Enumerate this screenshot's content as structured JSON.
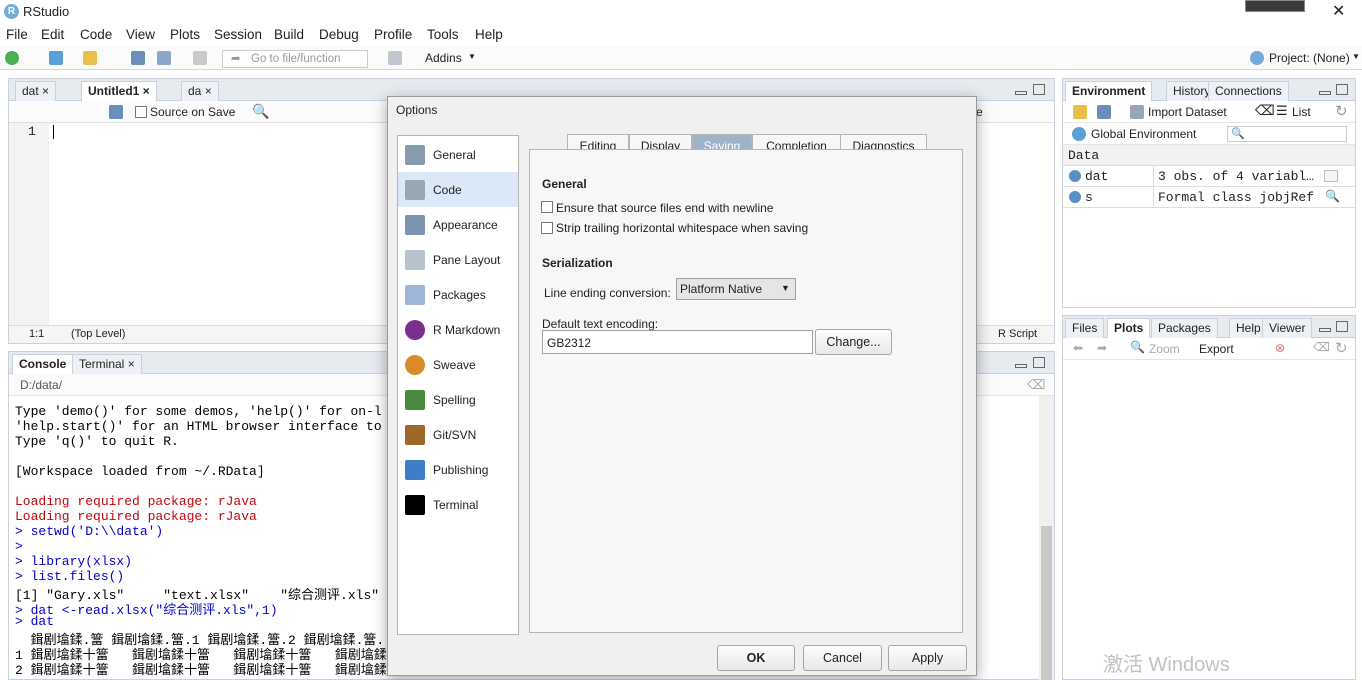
{
  "window": {
    "title": "RStudio",
    "close_glyph": "✕"
  },
  "menu": [
    "File",
    "Edit",
    "Code",
    "View",
    "Plots",
    "Session",
    "Build",
    "Debug",
    "Profile",
    "Tools",
    "Help"
  ],
  "toolbar": {
    "goto_placeholder": "Go to file/function",
    "addins_label": "Addins",
    "project_label": "Project: (None)"
  },
  "editor": {
    "tabs": [
      "dat",
      "Untitled1",
      "da"
    ],
    "source_on_save": "Source on Save",
    "line_number": "1",
    "status_position": "1:1",
    "status_scope": "(Top Level)",
    "status_type": "R Script",
    "source_fragment": "rce"
  },
  "console": {
    "tabs": [
      "Console",
      "Terminal"
    ],
    "path": "D:/data/",
    "lines": [
      {
        "cls": "blk",
        "text": "Type 'demo()' for some demos, 'help()' for on-l"
      },
      {
        "cls": "blk",
        "text": "'help.start()' for an HTML browser interface to"
      },
      {
        "cls": "blk",
        "text": "Type 'q()' to quit R."
      },
      {
        "cls": "blk",
        "text": ""
      },
      {
        "cls": "blk",
        "text": "[Workspace loaded from ~/.RData]"
      },
      {
        "cls": "blk",
        "text": ""
      },
      {
        "cls": "red",
        "text": "Loading required package: rJava"
      },
      {
        "cls": "red",
        "text": "Loading required package: rJava"
      },
      {
        "cls": "blue",
        "text": "> setwd('D:\\\\data')"
      },
      {
        "cls": "blue",
        "text": ">"
      },
      {
        "cls": "blue",
        "text": "> library(xlsx)"
      },
      {
        "cls": "blue",
        "text": "> list.files()"
      },
      {
        "cls": "blk",
        "text": "[1] \"Gary.xls\"     \"text.xlsx\"    \"综合测评.xls\""
      },
      {
        "cls": "blue",
        "text": "> dat <-read.xlsx(\"综合测评.xls\",1)"
      },
      {
        "cls": "blue",
        "text": "> dat"
      },
      {
        "cls": "blk",
        "text": "  鍓剧墖鍒.簹 鍓剧墖鍒.簹.1 鍓剧墖鍒.簹.2 鍓剧墖鍒.簹."
      },
      {
        "cls": "blk",
        "text": "1 鍓剧墖鍒十簹   鍓剧墖鍒十簹   鍓剧墖鍒十簹   鍓剧墖鍒"
      },
      {
        "cls": "blk",
        "text": "2 鍓剧墖鍒十簹   鍓剧墖鍒十簹   鍓剧墖鍒十簹   鍓剧墖鍒"
      }
    ]
  },
  "environment": {
    "tabs": [
      "Environment",
      "History",
      "Connections"
    ],
    "import_label": "Import Dataset",
    "list_label": "List",
    "global_env": "Global Environment",
    "section": "Data",
    "rows": [
      {
        "name": "dat",
        "value": "3 obs. of 4 variabl…"
      },
      {
        "name": "s",
        "value": "Formal class jobjRef"
      }
    ]
  },
  "files": {
    "tabs": [
      "Files",
      "Plots",
      "Packages",
      "Help",
      "Viewer"
    ],
    "zoom_label": "Zoom",
    "export_label": "Export"
  },
  "watermark": "激活 Windows",
  "dialog": {
    "title": "Options",
    "sidebar": [
      {
        "label": "General",
        "icon": "r-logo-icon",
        "color": "#8a9bb0"
      },
      {
        "label": "Code",
        "icon": "code-icon",
        "color": "#9aa6b2"
      },
      {
        "label": "Appearance",
        "icon": "appearance-icon",
        "color": "#7e93ad"
      },
      {
        "label": "Pane Layout",
        "icon": "pane-layout-icon",
        "color": "#b7c2ce"
      },
      {
        "label": "Packages",
        "icon": "packages-icon",
        "color": "#9fb6d6"
      },
      {
        "label": "R Markdown",
        "icon": "rmarkdown-icon",
        "color": "#7b2f8c"
      },
      {
        "label": "Sweave",
        "icon": "sweave-icon",
        "color": "#d98a2a"
      },
      {
        "label": "Spelling",
        "icon": "spelling-icon",
        "color": "#4a8a3a"
      },
      {
        "label": "Git/SVN",
        "icon": "git-svn-icon",
        "color": "#a0672a"
      },
      {
        "label": "Publishing",
        "icon": "publishing-icon",
        "color": "#3c7fc6"
      },
      {
        "label": "Terminal",
        "icon": "terminal-icon",
        "color": "#000000"
      }
    ],
    "tabs": [
      "Editing",
      "Display",
      "Saving",
      "Completion",
      "Diagnostics"
    ],
    "active_tab": "Saving",
    "general_heading": "General",
    "checkbox_newline": "Ensure that source files end with newline",
    "checkbox_whitespace": "Strip trailing horizontal whitespace when saving",
    "serialization_heading": "Serialization",
    "line_ending_label": "Line ending conversion:",
    "line_ending_value": "Platform Native",
    "encoding_label": "Default text encoding:",
    "encoding_value": "GB2312",
    "change_button": "Change...",
    "ok_button": "OK",
    "cancel_button": "Cancel",
    "apply_button": "Apply"
  }
}
